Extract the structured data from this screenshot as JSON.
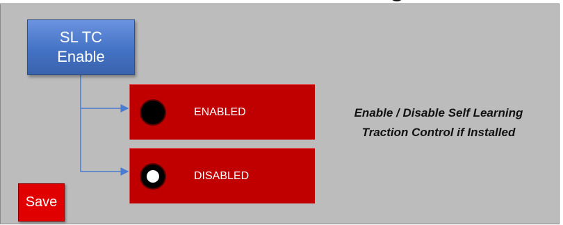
{
  "header": {
    "cut_title_fragment": "g"
  },
  "sltc_button": {
    "line1": "SL TC",
    "line2": "Enable"
  },
  "options": {
    "enabled": {
      "label": "ENABLED",
      "state": "unselected"
    },
    "disabled": {
      "label": "DISABLED",
      "state": "selected"
    }
  },
  "description": {
    "line1": "Enable / Disable Self Learning",
    "line2": "Traction Control if Installed"
  },
  "save_label": "Save",
  "colors": {
    "panel": "#bcbcbc",
    "blue_button": "#4472c4",
    "option_red": "#c00000",
    "save_red": "#e00000",
    "connector": "#4a7bd0"
  }
}
